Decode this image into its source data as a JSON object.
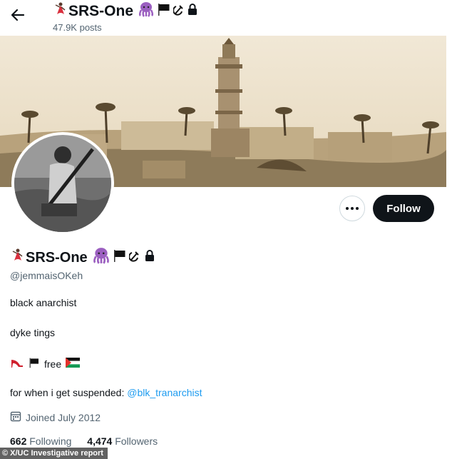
{
  "header": {
    "name": "SRS-One",
    "posts": "47.9K posts"
  },
  "profile": {
    "name": "SRS-One",
    "handle": "@jemmaisOKeh",
    "bio_line1": "black anarchist",
    "bio_line2": "dyke tings",
    "bio_line3_text": "free",
    "bio_line4_prefix": "for when i get suspended: ",
    "bio_line4_link": "@blk_tranarchist",
    "joined": "Joined July 2012",
    "following_count": "662",
    "following_label": "Following",
    "followers_count": "4,474",
    "followers_label": "Followers"
  },
  "actions": {
    "follow_label": "Follow"
  },
  "icons": [
    "back-arrow-icon",
    "dancer-emoji-icon",
    "octopus-emoji-icon",
    "black-flag-emoji-icon",
    "hammer-sickle-emoji-icon",
    "lock-icon",
    "more-icon",
    "high-heel-emoji-icon",
    "palestine-flag-emoji-icon",
    "calendar-icon"
  ],
  "colors": {
    "follow_bg": "#0f1419",
    "link": "#1d9bf0",
    "secondary_text": "#536471",
    "octopus": "#9b5fc0"
  },
  "watermark": "© X/UC Investigative report"
}
